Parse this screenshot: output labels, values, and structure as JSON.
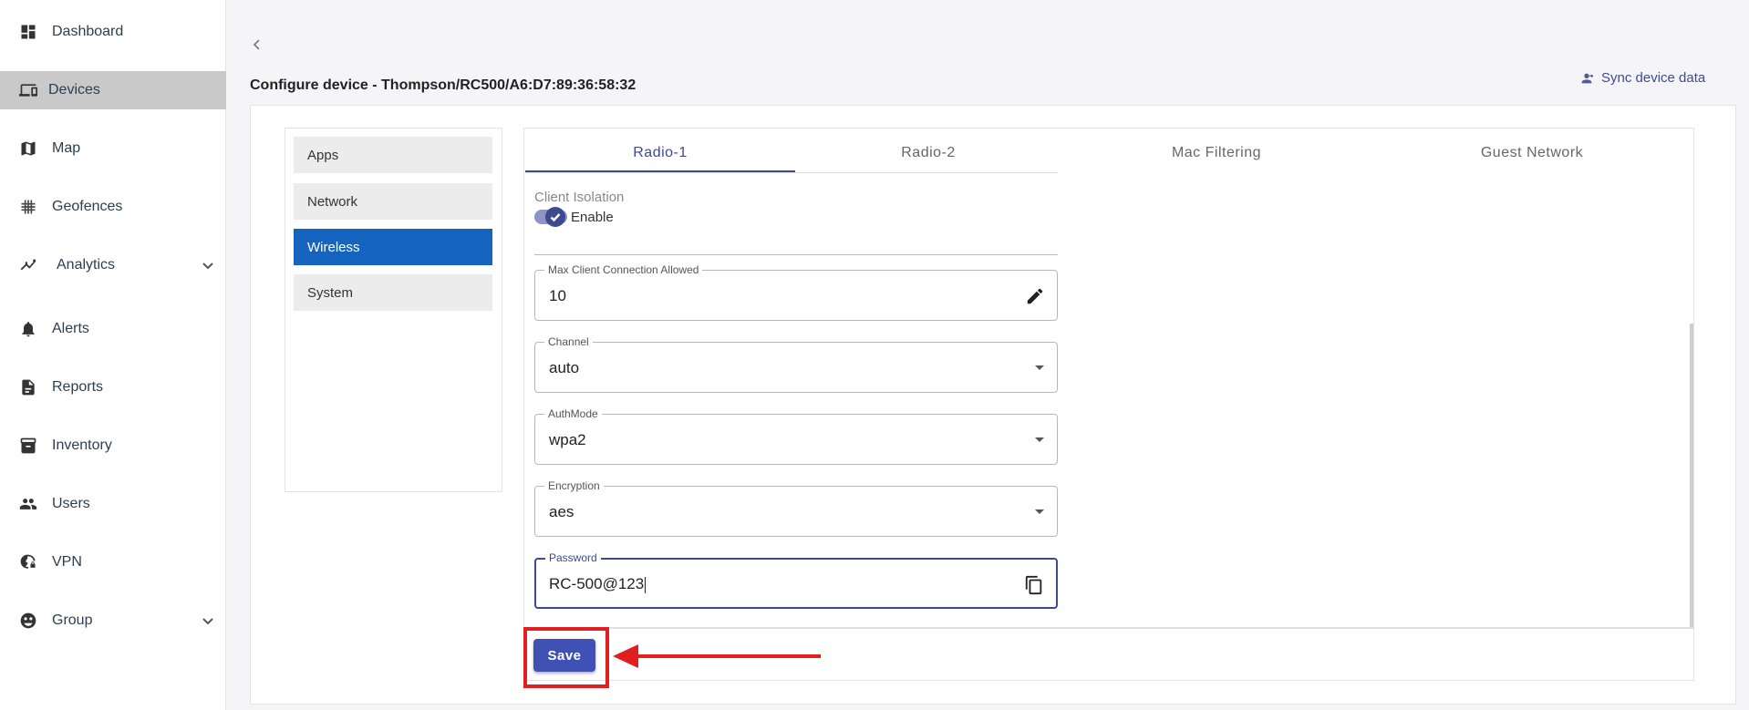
{
  "sidebar": {
    "items": [
      {
        "label": "Dashboard",
        "icon": "dashboard-icon"
      },
      {
        "label": "Devices",
        "icon": "devices-icon",
        "active": true
      },
      {
        "label": "Map",
        "icon": "map-icon"
      },
      {
        "label": "Geofences",
        "icon": "geofence-icon"
      },
      {
        "label": "Analytics",
        "icon": "analytics-icon",
        "expandable": true
      },
      {
        "label": "Alerts",
        "icon": "bell-icon"
      },
      {
        "label": "Reports",
        "icon": "reports-icon"
      },
      {
        "label": "Inventory",
        "icon": "inventory-icon"
      },
      {
        "label": "Users",
        "icon": "users-icon"
      },
      {
        "label": "VPN",
        "icon": "vpn-icon"
      },
      {
        "label": "Group",
        "icon": "group-icon",
        "expandable": true
      }
    ]
  },
  "header": {
    "title": "Configure device - Thompson/RC500/A6:D7:89:36:58:32",
    "sync_label": "Sync device data"
  },
  "config_menu": {
    "items": [
      "Apps",
      "Network",
      "Wireless",
      "System"
    ],
    "active": "Wireless"
  },
  "tabs": {
    "items": [
      "Radio-1",
      "Radio-2",
      "Mac Filtering",
      "Guest Network"
    ],
    "active": "Radio-1"
  },
  "form": {
    "client_isolation": {
      "label": "Client Isolation",
      "toggle_label": "Enable",
      "enabled": true
    },
    "max_client": {
      "label": "Max Client Connection Allowed",
      "value": "10"
    },
    "channel": {
      "label": "Channel",
      "value": "auto"
    },
    "auth_mode": {
      "label": "AuthMode",
      "value": "wpa2"
    },
    "encryption": {
      "label": "Encryption",
      "value": "aes"
    },
    "password": {
      "label": "Password",
      "value": "RC-500@123"
    },
    "save_label": "Save"
  },
  "colors": {
    "accent": "#3e4a8f",
    "active_menu": "#1565c0",
    "save_button": "#3f51b5",
    "annotation": "#e02020",
    "sidebar_active": "#c9c9c9"
  }
}
